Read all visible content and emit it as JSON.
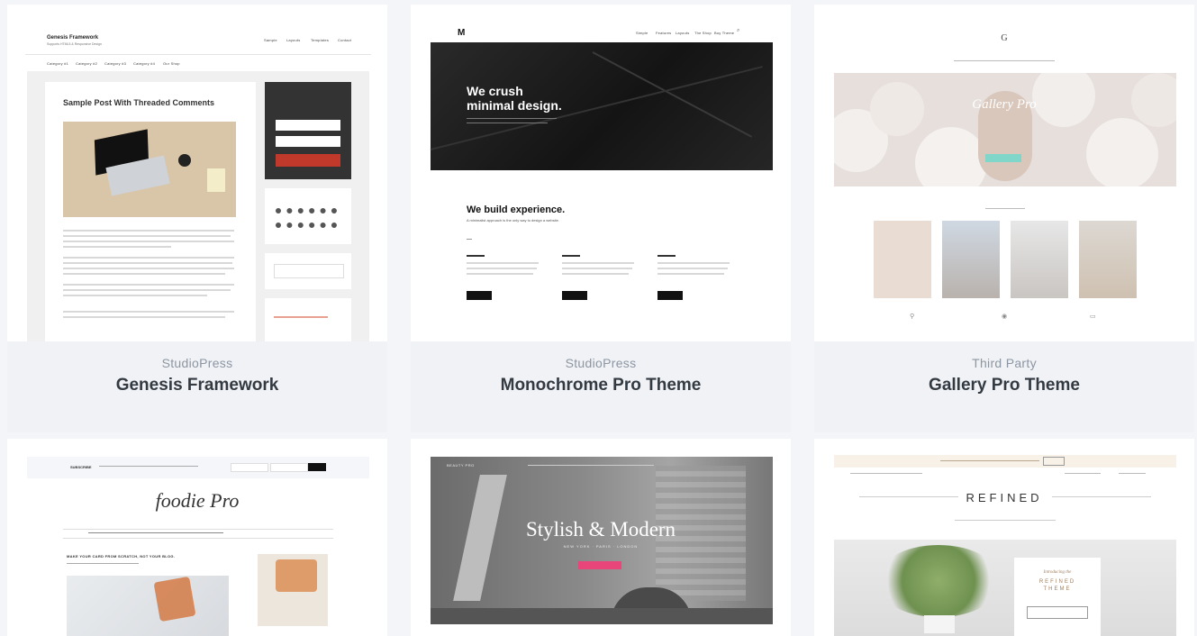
{
  "themes": [
    {
      "vendor": "StudioPress",
      "name": "Genesis Framework",
      "preview": {
        "site_title": "Genesis Framework",
        "tagline": "Supports HTML5 & Responsive Design",
        "nav": [
          "Sample",
          "Layouts",
          "Templates",
          "Contact"
        ],
        "subnav": [
          "Category #1",
          "Category #2",
          "Category #3",
          "Category #4",
          "Our Shop"
        ],
        "post_title": "Sample Post With Threaded Comments"
      }
    },
    {
      "vendor": "StudioPress",
      "name": "Monochrome Pro Theme",
      "preview": {
        "logo": "M",
        "nav": [
          "Simple",
          "Features",
          "Layouts",
          "The Shop",
          "Buy Theme"
        ],
        "hero_line1": "We crush",
        "hero_line2": "minimal design.",
        "section_title": "We build experience.",
        "section_sub": "A minimalist approach is the only way to design a website."
      }
    },
    {
      "vendor": "Third Party",
      "name": "Gallery Pro Theme",
      "preview": {
        "logo": "G",
        "hero_title": "Gallery Pro"
      }
    },
    {
      "vendor": "",
      "name": "",
      "preview": {
        "logo": "foodie Pro",
        "subscribe": "SUBSCRIBE",
        "headline": "MAKE YOUR CARD FROM SCRATCH, NOT YOUR BLOG."
      }
    },
    {
      "vendor": "",
      "name": "",
      "preview": {
        "logo": "BEAUTY PRO",
        "hero_title": "Stylish & Modern",
        "hero_sub": "NEW YORK · PARIS · LONDON"
      }
    },
    {
      "vendor": "",
      "name": "",
      "preview": {
        "logo": "REFINED",
        "card_line1": "Introducing the",
        "card_line2": "REFINED",
        "card_line3": "THEME"
      }
    }
  ],
  "colors": {
    "background": "#f3f5f8",
    "vendor_text": "#8d96a3",
    "name_text": "#333a42",
    "genesis_accent": "#c0392b",
    "mono_hero": "#1a1a1a",
    "gallery_accent": "#7fd6c9",
    "beauty_accent": "#e8457a"
  }
}
